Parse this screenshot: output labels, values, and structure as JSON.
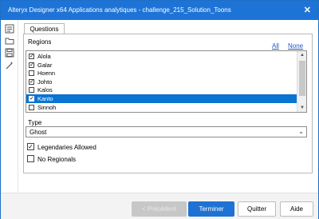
{
  "window": {
    "title": "Alteryx Designer x64 Applications analytiques - challenge_215_Solution_Toons",
    "close": "✕"
  },
  "sidebar": {
    "tools": [
      {
        "icon": "list-icon"
      },
      {
        "icon": "folder-icon"
      },
      {
        "icon": "save-icon"
      },
      {
        "icon": "magic-wand-icon"
      }
    ]
  },
  "tab": {
    "label": "Questions"
  },
  "regions": {
    "label": "Regions",
    "all_link": "All",
    "none_link": "None",
    "items": [
      {
        "label": "Alola",
        "checked": true,
        "selected": false
      },
      {
        "label": "Galar",
        "checked": true,
        "selected": false
      },
      {
        "label": "Hoenn",
        "checked": false,
        "selected": false
      },
      {
        "label": "Johto",
        "checked": true,
        "selected": false
      },
      {
        "label": "Kalos",
        "checked": false,
        "selected": false
      },
      {
        "label": "Kanto",
        "checked": true,
        "selected": true
      },
      {
        "label": "Sinnoh",
        "checked": false,
        "selected": false
      }
    ]
  },
  "type": {
    "label": "Type",
    "value": "Ghost"
  },
  "options": {
    "legendaries_label": "Legendaries Allowed",
    "legendaries_checked": true,
    "no_regionals_label": "No Regionals",
    "no_regionals_checked": false
  },
  "footer": {
    "prev": "< Précédent",
    "finish": "Terminer",
    "quit": "Quitter",
    "help": "Aide"
  },
  "colors": {
    "titlebar": "#1e74d6",
    "selection": "#0a74d2",
    "primary_button": "#1e72d3",
    "link": "#1f55c8"
  }
}
